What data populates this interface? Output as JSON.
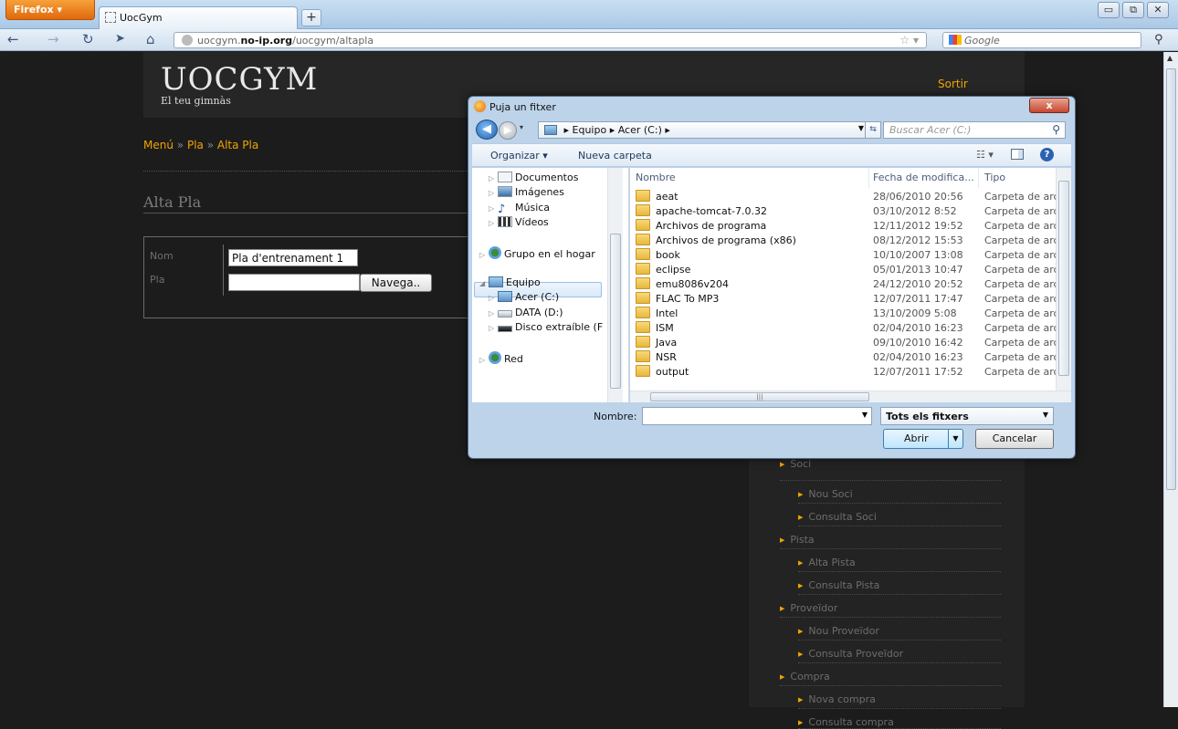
{
  "browser": {
    "menu_button": "Firefox ▾",
    "tab_title": "UocGym",
    "new_tab": "+",
    "url_host": "uocgym.",
    "url_domain": "no-ip.org",
    "url_path": "/uocgym/altapla",
    "search_placeholder": "Google",
    "window_buttons": [
      "▭",
      "⧉",
      "✕"
    ]
  },
  "site": {
    "logo": "UOCGYM",
    "slogan": "El teu gimnàs",
    "logout": "Sortir"
  },
  "breadcrumb": {
    "items": [
      "Menú",
      "Pla",
      "Alta Pla"
    ],
    "separator": "»"
  },
  "page": {
    "title": "Alta Pla"
  },
  "form": {
    "nom_label": "Nom",
    "nom_value": "Pla d'entrenament 1",
    "pla_label": "Pla",
    "pla_value": "",
    "browse_button": "Navega.."
  },
  "sidebar": {
    "items": [
      {
        "label": "Soci",
        "level": 1
      },
      {
        "label": "Nou Soci",
        "level": 2
      },
      {
        "label": "Consulta Soci",
        "level": 2
      },
      {
        "label": "Pista",
        "level": 1
      },
      {
        "label": "Alta Pista",
        "level": 2
      },
      {
        "label": "Consulta Pista",
        "level": 2
      },
      {
        "label": "Proveïdor",
        "level": 1
      },
      {
        "label": "Nou Proveïdor",
        "level": 2
      },
      {
        "label": "Consulta Proveïdor",
        "level": 2
      },
      {
        "label": "Compra",
        "level": 1
      },
      {
        "label": "Nova compra",
        "level": 2
      },
      {
        "label": "Consulta compra",
        "level": 2
      }
    ]
  },
  "dialog": {
    "title": "Puja un fitxer",
    "close": "x",
    "path": [
      "Equipo",
      "Acer (C:)"
    ],
    "search_placeholder": "Buscar Acer (C:)",
    "organize": "Organizar ▾",
    "new_folder": "Nueva carpeta",
    "nav_items": [
      {
        "label": "Documentos",
        "icon": "documents-icon",
        "indent": 1
      },
      {
        "label": "Imágenes",
        "icon": "pictures-icon",
        "indent": 1
      },
      {
        "label": "Música",
        "icon": "music-icon",
        "indent": 1
      },
      {
        "label": "Vídeos",
        "icon": "videos-icon",
        "indent": 1
      },
      {
        "label": "Grupo en el hogar",
        "icon": "homegroup-icon",
        "indent": 0
      },
      {
        "label": "Equipo",
        "icon": "computer-icon",
        "indent": 0
      },
      {
        "label": "Acer (C:)",
        "icon": "drive-c-icon",
        "indent": 1
      },
      {
        "label": "DATA (D:)",
        "icon": "drive-d-icon",
        "indent": 1
      },
      {
        "label": "Disco extraíble (F",
        "icon": "removable-drive-icon",
        "indent": 1
      },
      {
        "label": "Red",
        "icon": "network-icon",
        "indent": 0
      }
    ],
    "columns": [
      "Nombre",
      "Fecha de modifica...",
      "Tipo"
    ],
    "files": [
      {
        "name": "aeat",
        "date": "28/06/2010 20:56",
        "type": "Carpeta de arc"
      },
      {
        "name": "apache-tomcat-7.0.32",
        "date": "03/10/2012 8:52",
        "type": "Carpeta de arc"
      },
      {
        "name": "Archivos de programa",
        "date": "12/11/2012 19:52",
        "type": "Carpeta de arc"
      },
      {
        "name": "Archivos de programa (x86)",
        "date": "08/12/2012 15:53",
        "type": "Carpeta de arc"
      },
      {
        "name": "book",
        "date": "10/10/2007 13:08",
        "type": "Carpeta de arc"
      },
      {
        "name": "eclipse",
        "date": "05/01/2013 10:47",
        "type": "Carpeta de arc"
      },
      {
        "name": "emu8086v204",
        "date": "24/12/2010 20:52",
        "type": "Carpeta de arc"
      },
      {
        "name": "FLAC To MP3",
        "date": "12/07/2011 17:47",
        "type": "Carpeta de arc"
      },
      {
        "name": "Intel",
        "date": "13/10/2009 5:08",
        "type": "Carpeta de arc"
      },
      {
        "name": "ISM",
        "date": "02/04/2010 16:23",
        "type": "Carpeta de arc"
      },
      {
        "name": "Java",
        "date": "09/10/2010 16:42",
        "type": "Carpeta de arc"
      },
      {
        "name": "NSR",
        "date": "02/04/2010 16:23",
        "type": "Carpeta de arc"
      },
      {
        "name": "output",
        "date": "12/07/2011 17:52",
        "type": "Carpeta de arc"
      }
    ],
    "filename_label": "Nombre:",
    "filename_value": "",
    "filetype": "Tots els fitxers",
    "open_button": "Abrir",
    "cancel_button": "Cancelar"
  }
}
